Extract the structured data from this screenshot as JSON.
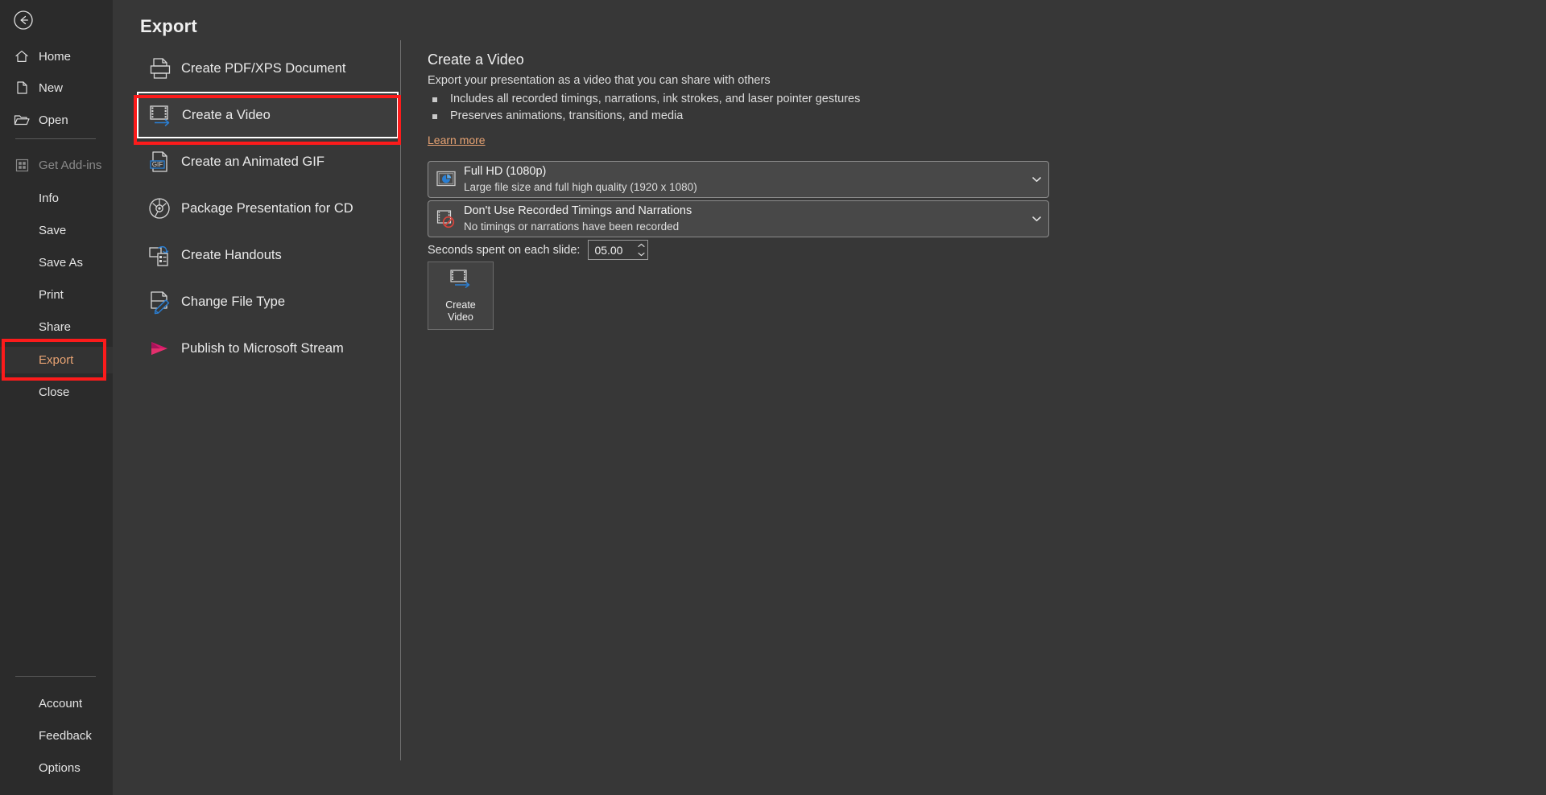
{
  "header": {
    "title": "Export"
  },
  "sidebar": {
    "back_icon": "back-arrow-icon",
    "items": [
      {
        "label": "Home",
        "icon": "home-icon",
        "state": "normal"
      },
      {
        "label": "New",
        "icon": "page-icon",
        "state": "normal"
      },
      {
        "label": "Open",
        "icon": "folder-icon",
        "state": "normal"
      },
      {
        "label": "Get Add-ins",
        "icon": "addins-icon",
        "state": "disabled"
      },
      {
        "label": "Info",
        "icon": "",
        "state": "normal"
      },
      {
        "label": "Save",
        "icon": "",
        "state": "normal"
      },
      {
        "label": "Save As",
        "icon": "",
        "state": "normal"
      },
      {
        "label": "Print",
        "icon": "",
        "state": "normal"
      },
      {
        "label": "Share",
        "icon": "",
        "state": "normal"
      },
      {
        "label": "Export",
        "icon": "",
        "state": "active"
      },
      {
        "label": "Close",
        "icon": "",
        "state": "normal"
      },
      {
        "label": "Account",
        "icon": "",
        "state": "normal"
      },
      {
        "label": "Feedback",
        "icon": "",
        "state": "normal"
      },
      {
        "label": "Options",
        "icon": "",
        "state": "normal"
      }
    ]
  },
  "export_list": [
    {
      "label": "Create PDF/XPS Document",
      "icon": "pdf-xps-icon",
      "selected": false
    },
    {
      "label": "Create a Video",
      "icon": "video-icon",
      "selected": true
    },
    {
      "label": "Create an Animated GIF",
      "icon": "gif-icon",
      "selected": false
    },
    {
      "label": "Package Presentation for CD",
      "icon": "cd-icon",
      "selected": false
    },
    {
      "label": "Create Handouts",
      "icon": "handouts-icon",
      "selected": false
    },
    {
      "label": "Change File Type",
      "icon": "file-type-icon",
      "selected": false
    },
    {
      "label": "Publish to Microsoft Stream",
      "icon": "stream-icon",
      "selected": false
    }
  ],
  "detail": {
    "title": "Create a Video",
    "subtitle": "Export your presentation as a video that you can share with others",
    "bullets": [
      "Includes all recorded timings, narrations, ink strokes, and laser pointer gestures",
      "Preserves animations, transitions, and media"
    ],
    "learn_more": "Learn more",
    "quality_combo": {
      "icon": "video-quality-icon",
      "line1": "Full HD (1080p)",
      "line2": "Large file size and full high quality (1920 x 1080)",
      "chevron": "chevron-down-icon"
    },
    "timings_combo": {
      "icon": "no-timings-icon",
      "line1": "Don't Use Recorded Timings and Narrations",
      "line2": "No timings or narrations have been recorded",
      "chevron": "chevron-down-icon"
    },
    "seconds": {
      "label": "Seconds spent on each slide:",
      "value": "05.00"
    },
    "create_button": {
      "icon": "video-icon",
      "line1": "Create",
      "line2": "Video"
    }
  },
  "colors": {
    "sidebar_bg": "#2b2b2b",
    "main_bg": "#373737",
    "accent_orange": "#e8a373",
    "annotation_red": "#fc1b1b",
    "combo_bg": "#484848",
    "stream_pink": "#d6196a",
    "icon_blue": "#2a7fd4"
  },
  "annotations": [
    {
      "name": "create-a-video-highlight"
    },
    {
      "name": "export-nav-highlight"
    }
  ]
}
